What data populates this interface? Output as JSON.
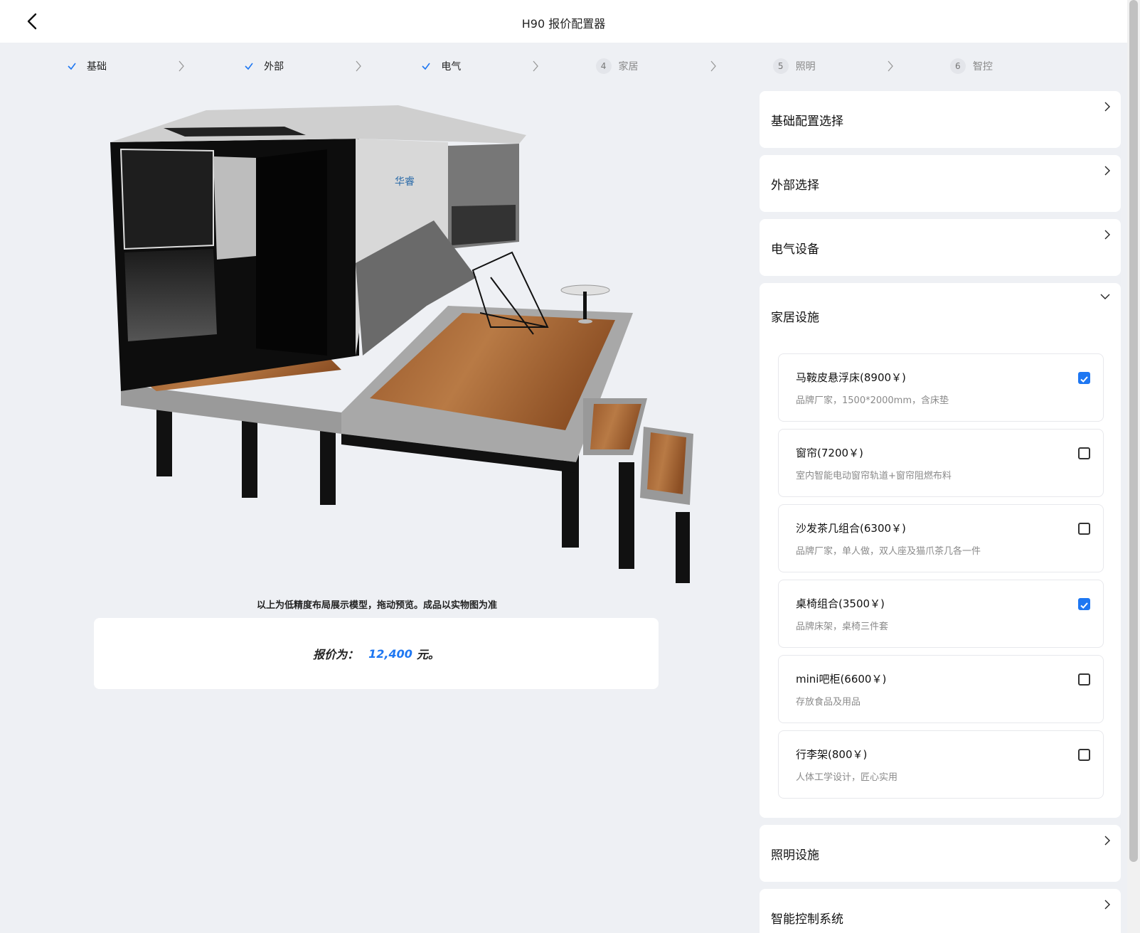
{
  "header": {
    "title": "H90 报价配置器",
    "back_icon": "back-chevron-icon"
  },
  "steps": [
    {
      "index": "1",
      "label": "基础",
      "done": true
    },
    {
      "index": "2",
      "label": "外部",
      "done": true
    },
    {
      "index": "3",
      "label": "电气",
      "done": true
    },
    {
      "index": "4",
      "label": "家居",
      "done": false
    },
    {
      "index": "5",
      "label": "照明",
      "done": false
    },
    {
      "index": "6",
      "label": "智控",
      "done": false
    }
  ],
  "preview": {
    "note": "以上为低精度布局展示模型，拖动预览。成品以实物图为准",
    "logo_text": "华睿"
  },
  "price": {
    "label": "报价为：",
    "value": "12,400",
    "unit": "元。"
  },
  "sections": {
    "basic": "基础配置选择",
    "exterior": "外部选择",
    "electrical": "电气设备",
    "home": "家居设施",
    "lighting": "照明设施",
    "smart": "智能控制系统"
  },
  "home_items": [
    {
      "name": "马鞍皮悬浮床(8900￥)",
      "desc": "品牌厂家，1500*2000mm，含床垫",
      "checked": true
    },
    {
      "name": "窗帘(7200￥)",
      "desc": "室内智能电动窗帘轨道+窗帘阻燃布料",
      "checked": false
    },
    {
      "name": "沙发茶几组合(6300￥)",
      "desc": "品牌厂家，单人做，双人座及猫爪茶几各一件",
      "checked": false
    },
    {
      "name": "桌椅组合(3500￥)",
      "desc": "品牌床架，桌椅三件套",
      "checked": true
    },
    {
      "name": "mini吧柜(6600￥)",
      "desc": "存放食品及用品",
      "checked": false
    },
    {
      "name": "行李架(800￥)",
      "desc": "人体工学设计，匠心实用",
      "checked": false
    }
  ],
  "colors": {
    "accent": "#1e77f2",
    "background": "#eef0f4",
    "card": "#ffffff"
  }
}
